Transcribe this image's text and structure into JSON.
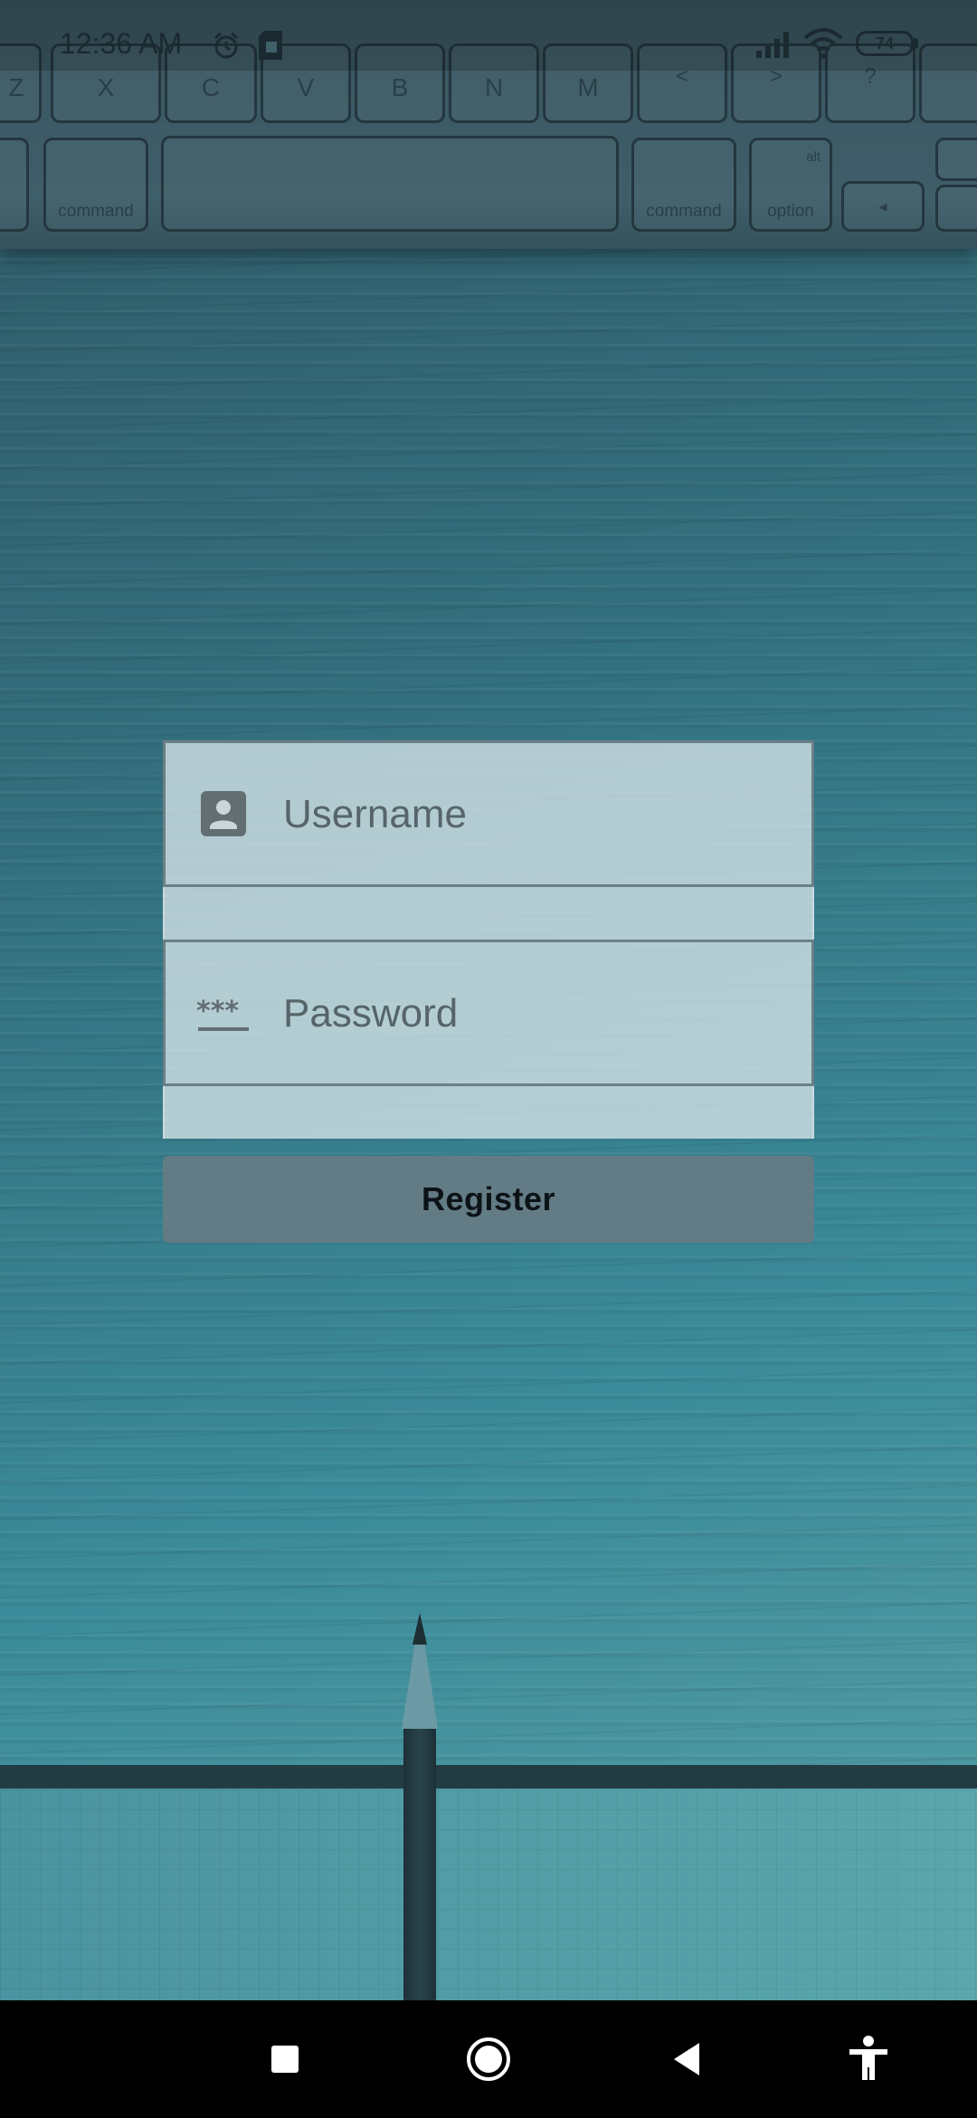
{
  "status_bar": {
    "time": "12:36 AM",
    "battery_level": "74",
    "icons": [
      "alarm-icon",
      "sim-card-icon",
      "signal-icon",
      "wifi-icon",
      "battery-icon"
    ]
  },
  "background_keyboard": {
    "row1_keys": [
      "Z",
      "X",
      "C",
      "V",
      "B",
      "N",
      "M",
      "<",
      ">",
      "?"
    ],
    "row2_keys": [
      "command",
      "command",
      "option",
      "alt"
    ]
  },
  "form": {
    "username": {
      "value": "",
      "placeholder": "Username",
      "icon": "account-box-icon"
    },
    "password": {
      "value": "",
      "placeholder": "Password",
      "icon": "password-icon"
    },
    "register_label": "Register"
  },
  "nav_bar": {
    "buttons": [
      "recents-icon",
      "home-icon",
      "back-icon",
      "accessibility-icon"
    ]
  },
  "colors": {
    "background_dark": "#2f5866",
    "background_light": "#5aa3a9",
    "field_background": "#d6e4e8",
    "button_background": "#637b85",
    "nav_bar": "#000000"
  }
}
